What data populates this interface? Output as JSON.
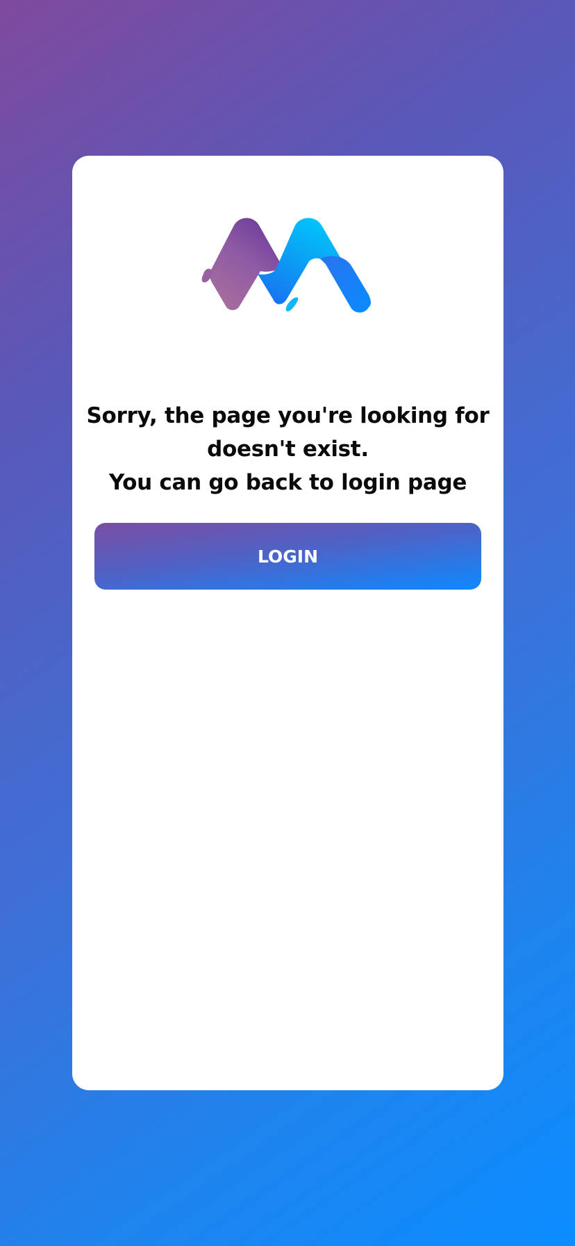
{
  "logo": {
    "icon": "brand-m-logo"
  },
  "message": {
    "line1": "Sorry, the page you're looking for",
    "line2": "doesn't exist.",
    "line3": "You can go back to login page"
  },
  "login_button": {
    "label": "LOGIN"
  },
  "colors": {
    "background_start": "#7f4a9e",
    "background_end": "#0a8cff",
    "card": "#ffffff",
    "text": "#0a0a0a",
    "button_text": "#ffffff"
  }
}
